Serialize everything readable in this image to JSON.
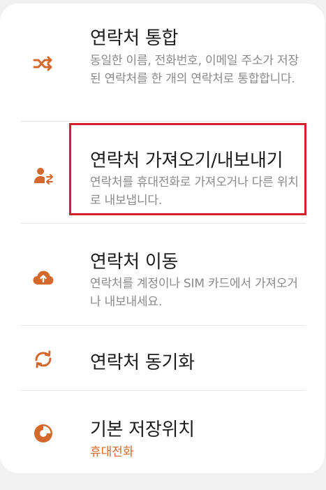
{
  "menu": {
    "items": [
      {
        "title": "연락처 통합",
        "description": "동일한 이름, 전화번호, 이메일 주소가 저장된 연락처를 한 개의 연락처로 통합합니다.",
        "icon": "merge-icon"
      },
      {
        "title": "연락처 가져오기/내보내기",
        "description": "연락처를 휴대전화로 가져오거나 다른 위치로 내보냅니다.",
        "icon": "import-export-contacts-icon"
      },
      {
        "title": "연락처 이동",
        "description": "연락처를 계정이나 SIM 카드에서 가져오거나 내보내세요.",
        "icon": "cloud-upload-icon"
      },
      {
        "title": "연락처 동기화",
        "icon": "sync-icon"
      },
      {
        "title": "기본 저장위치",
        "subtitle": "휴대전화",
        "icon": "storage-location-icon"
      }
    ]
  },
  "colors": {
    "accent": "#d4692e",
    "highlight_border": "#d61f2d",
    "title_text": "#1c1c1c",
    "description_text": "#8a8a8a",
    "background": "#f1f1f1"
  }
}
